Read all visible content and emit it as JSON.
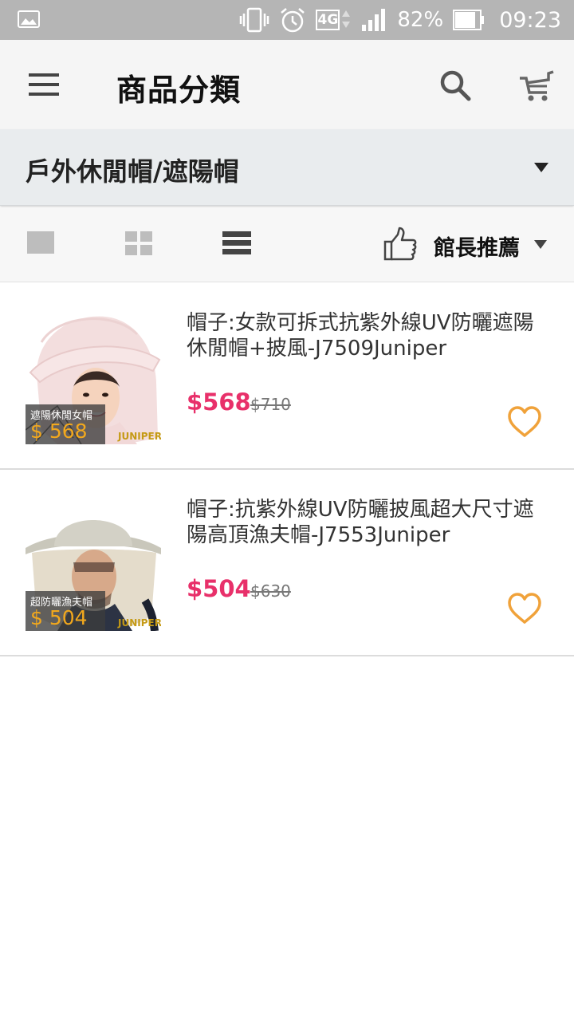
{
  "status_bar": {
    "network": "4G",
    "battery_pct": "82%",
    "time": "09:23",
    "icons": [
      "gallery-notification-icon",
      "vibrate-icon",
      "alarm-icon",
      "signal-icon",
      "battery-icon"
    ]
  },
  "header": {
    "title": "商品分類",
    "icons": [
      "menu-icon",
      "search-icon",
      "cart-icon"
    ]
  },
  "category": {
    "selected": "戶外休閒帽/遮陽帽"
  },
  "toolbar": {
    "sort_label": "館長推薦",
    "view_modes": [
      "single-view",
      "grid-view",
      "list-view"
    ]
  },
  "products": [
    {
      "title": "帽子:女款可拆式抗紫外線UV防曬遮陽休閒帽+披風-J7509Juniper",
      "price": "$568",
      "original_price": "$710",
      "badge_title": "遮陽休閒女帽",
      "badge_price": "$ 568",
      "brand_mark": "JUNIPER"
    },
    {
      "title": "帽子:抗紫外線UV防曬披風超大尺寸遮陽高頂漁夫帽-J7553Juniper",
      "price": "$504",
      "original_price": "$630",
      "badge_title": "超防曬漁夫帽",
      "badge_price": "$ 504",
      "brand_mark": "JUNIPER"
    }
  ],
  "colors": {
    "status_bar": "#b5b5b5",
    "app_bar": "#f5f5f5",
    "category_bar": "#e9ecee",
    "price": "#e8306a",
    "heart": "#f0a23a",
    "badge_price": "#f2a81d"
  }
}
